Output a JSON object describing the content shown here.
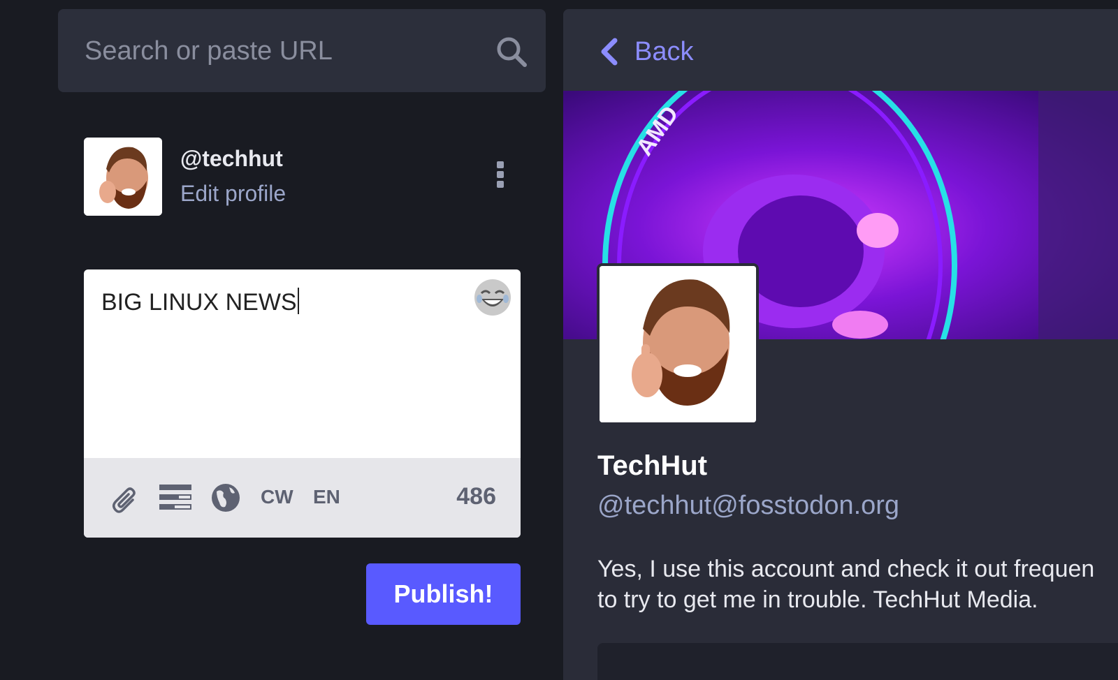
{
  "search": {
    "placeholder": "Search or paste URL",
    "icon": "search-icon"
  },
  "account": {
    "handle": "@techhut",
    "edit_profile": "Edit profile"
  },
  "compose": {
    "text": "BIG LINUX NEWS",
    "toolbar": {
      "attach_icon": "paperclip-icon",
      "poll_icon": "poll-icon",
      "visibility_icon": "globe-icon",
      "cw_label": "CW",
      "language_label": "EN",
      "char_count": "486"
    },
    "emoji_icon": "laughing-emoji-icon"
  },
  "publish_label": "Publish!",
  "profile": {
    "back_label": "Back",
    "display_name": "TechHut",
    "account": "@techhut@fosstodon.org",
    "bio_line1": "Yes, I use this account and check it out frequen",
    "bio_line2": "to try to get me in trouble. TechHut Media.",
    "banner_text": "AMD"
  },
  "colors": {
    "background": "#191b22",
    "panel": "#2c2f3b",
    "accent": "#595aff",
    "link": "#8c8dff",
    "muted_text": "#9ba6c9"
  }
}
